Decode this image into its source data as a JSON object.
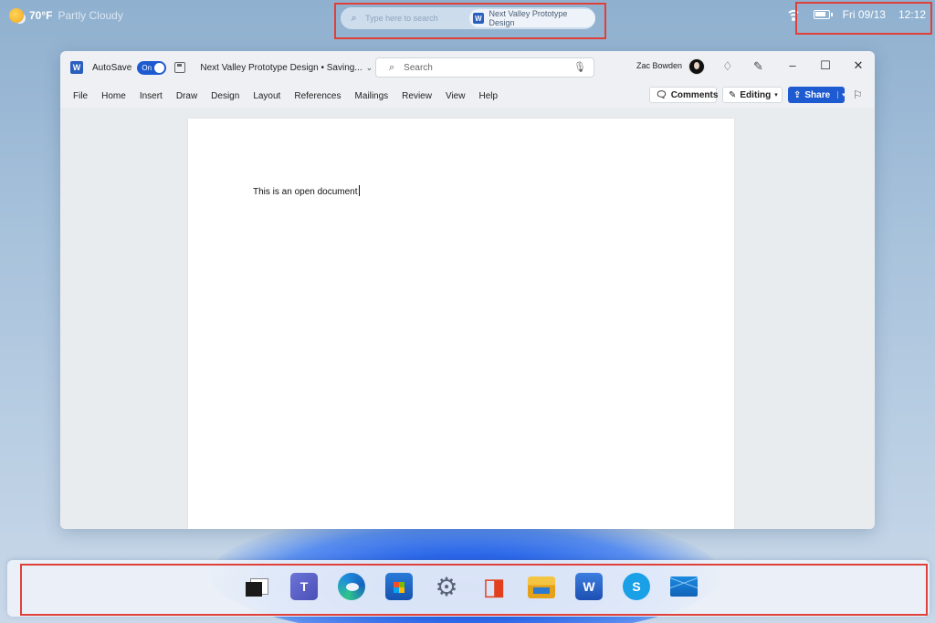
{
  "topbar": {
    "weather": {
      "temp": "70°F",
      "condition": "Partly Cloudy",
      "icon": "partly-cloudy-icon"
    },
    "search": {
      "placeholder": "Type here to search",
      "active_doc": "Next Valley Prototype Design"
    },
    "tray": {
      "date": "Fri 09/13",
      "time": "12:12",
      "icons": [
        "wifi-icon",
        "battery-icon"
      ]
    }
  },
  "word": {
    "app_letter": "W",
    "autosave_label": "AutoSave",
    "autosave_state": "On",
    "doc_title": "Next Valley Prototype Design • Saving...",
    "search_placeholder": "Search",
    "user_name": "Zac Bowden",
    "menu": [
      "File",
      "Home",
      "Insert",
      "Draw",
      "Design",
      "Layout",
      "References",
      "Mailings",
      "Review",
      "View",
      "Help"
    ],
    "comments_label": "Comments",
    "editing_label": "Editing",
    "share_label": "Share",
    "document_text": "This is an open document",
    "accent": "#1f5bd0"
  },
  "taskbar": {
    "apps": [
      "Start",
      "Task View",
      "Teams",
      "Edge",
      "Microsoft Store",
      "Settings",
      "Office",
      "File Explorer",
      "Word",
      "Skype",
      "Mail"
    ],
    "word_letter": "W",
    "skype_letter": "S"
  },
  "highlight_color": "#e0403a"
}
